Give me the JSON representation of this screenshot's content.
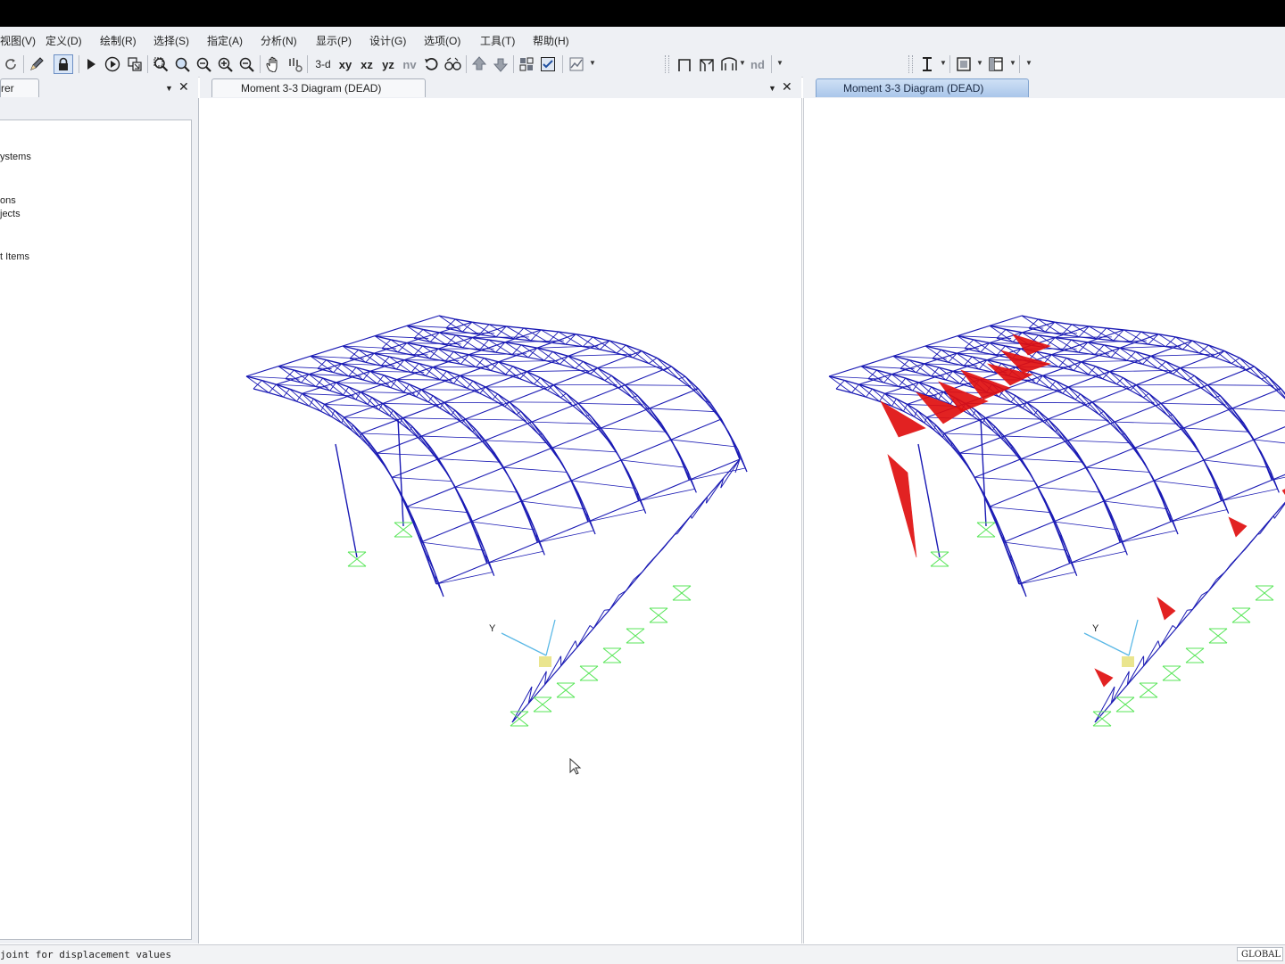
{
  "menu": {
    "items": [
      "视图(V)",
      "定义(D)",
      "绘制(R)",
      "选择(S)",
      "指定(A)",
      "分析(N)",
      "显示(P)",
      "设计(G)",
      "选项(O)",
      "工具(T)",
      "帮助(H)"
    ]
  },
  "toolbar": {
    "view_3d": "3-d",
    "view_xy": "xy",
    "view_xz": "xz",
    "view_yz": "yz",
    "view_nv": "nv",
    "label_nd": "nd",
    "icons": [
      "undo-icon",
      "redo-icon",
      "pencil-icon",
      "lock-icon",
      "run-icon",
      "run-step-icon",
      "model-alive-icon",
      "zoom-window-icon",
      "zoom-restore-icon",
      "zoom-previous-icon",
      "zoom-in-icon",
      "zoom-out-icon",
      "pan-icon",
      "rubber-band-icon",
      "rotate-3d-icon",
      "perspective-icon",
      "move-up-icon",
      "move-down-icon",
      "object-shrink-icon",
      "set-display-options-icon",
      "draw-frame-icon",
      "draw-portal-icon",
      "draw-arc-icon",
      "section-i-icon",
      "area-icon",
      "table-icon"
    ]
  },
  "left_panel": {
    "tab_label": "rer",
    "tree": [
      "ystems",
      "ons",
      "jects",
      "t Items"
    ]
  },
  "tabs": {
    "left_view": "Moment 3-3 Diagram (DEAD)",
    "right_view": "Moment 3-3 Diagram (DEAD)"
  },
  "views": {
    "axis_label": "Y",
    "colors": {
      "frame": "#1a1ab4",
      "moment_diagram": "#e01010",
      "support": "#5ae65a",
      "axis": "#5ab8e6",
      "origin": "#e6e07a"
    }
  },
  "status": {
    "message": "joint for displacement values",
    "coord_system": "GLOBAL"
  }
}
